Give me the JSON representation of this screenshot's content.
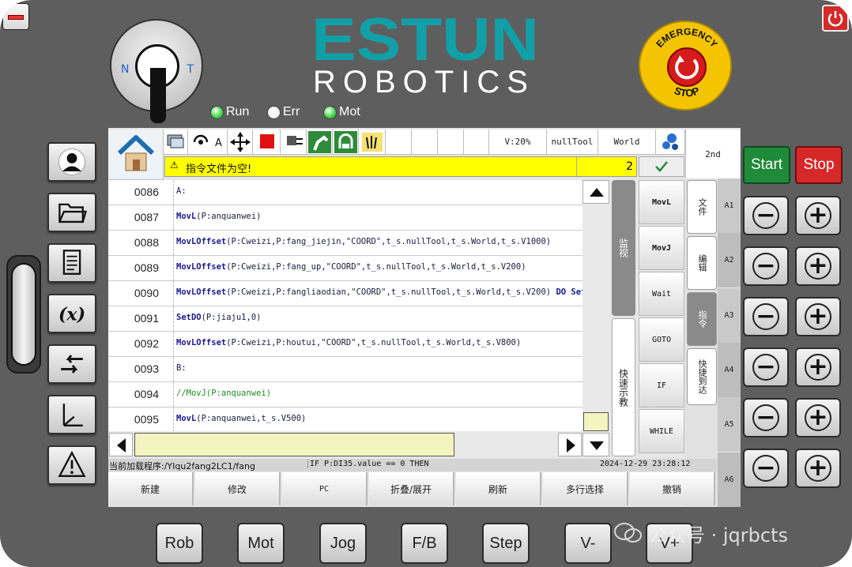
{
  "brand": {
    "logo": "ESTUN",
    "sub": "ROBOTICS"
  },
  "key_switch": {
    "left": "N",
    "right": "T"
  },
  "emergency": {
    "label": "EMERGENCY STOP",
    "top": "EMERGENCY",
    "bottom": "STOP"
  },
  "leds": [
    {
      "label": "Run",
      "color": "#3dd43d"
    },
    {
      "label": "Err",
      "color": "#f4f4f4"
    },
    {
      "label": "Mot",
      "color": "#3dd43d"
    }
  ],
  "toolbar": {
    "speed": "V:20%",
    "tool": "nullTool",
    "frame": "World",
    "second": "2nd"
  },
  "message": {
    "icon": "warning-icon",
    "text": "指令文件为空!",
    "count": "2"
  },
  "lines": [
    {
      "num": "0086",
      "code": "A:"
    },
    {
      "num": "0087",
      "kw": "MovL",
      "rest": "(P:anquanwei)"
    },
    {
      "num": "0088",
      "kw": "MovLOffset",
      "rest": "(P:Cweizi,P:fang_jiejin,\"COORD\",t_s.nullTool,t_s.World,t_s.V1000)"
    },
    {
      "num": "0089",
      "kw": "MovLOffset",
      "rest": "(P:Cweizi,P:fang_up,\"COORD\",t_s.nullTool,t_s.World,t_s.V200)"
    },
    {
      "num": "0090",
      "kw": "MovLOffset",
      "rest": "(P:Cweizi,P:fangliaodian,\"COORD\",t_s.nullTool,t_s.World,t_s.V200) ",
      "kw2": "DO SetD"
    },
    {
      "num": "0091",
      "kw": "SetDO",
      "rest": "(P:jiaju1,0)"
    },
    {
      "num": "0092",
      "kw": "MovLOffset",
      "rest": "(P:Cweizi,P:houtui,\"COORD\",t_s.nullTool,t_s.World,t_s.V800)"
    },
    {
      "num": "0093",
      "code": "B:"
    },
    {
      "num": "0094",
      "comment": "//MovJ(P:anquanwei)"
    },
    {
      "num": "0095",
      "kw": "MovL",
      "rest": "(P:anquanwei,t_s.V500)"
    }
  ],
  "side_tabs": {
    "monitor": "监视",
    "quick_teach": "快速示教"
  },
  "instructions": [
    "MovL",
    "MovJ",
    "Wait",
    "GOTO",
    "IF",
    "WHILE"
  ],
  "category_tabs": [
    "文件",
    "编辑",
    "指令",
    "快捷到达"
  ],
  "axes": [
    "A1",
    "A2",
    "A3",
    "A4",
    "A5",
    "A6"
  ],
  "status": {
    "program": "当前加载程序:/YIqu2fang2LC1/fang",
    "current": "IF P:DI35.value == 0 THEN",
    "datetime": "2024-12-29 23:28:12"
  },
  "func_buttons": [
    "新建",
    "修改",
    "PC",
    "折叠/展开",
    "刷新",
    "多行选择",
    "撤销"
  ],
  "start_label": "Start",
  "stop_label": "Stop",
  "jog_minus": "−",
  "jog_plus": "+",
  "bottom_buttons": [
    "Rob",
    "Mot",
    "Jog",
    "F/B",
    "Step",
    "V-",
    "V+"
  ],
  "watermark": "公众号 · jqrbcts"
}
